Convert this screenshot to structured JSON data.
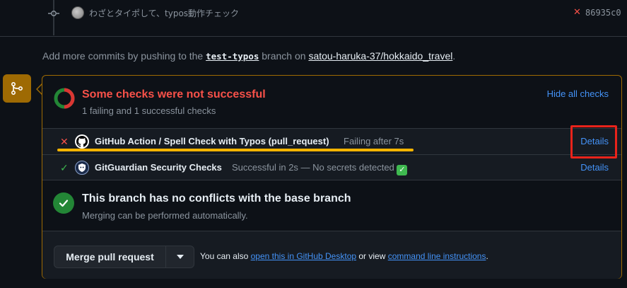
{
  "commit": {
    "message": "わざとタイポして、typos動作チェック",
    "status_icon": "x-icon",
    "sha": "86935c0"
  },
  "add_more": {
    "prefix": "Add more commits by pushing to the ",
    "branch": "test-typos",
    "middle": " branch on ",
    "repo": "satou-haruka-37/hokkaido_travel",
    "suffix": "."
  },
  "checks": {
    "title": "Some checks were not successful",
    "subtitle": "1 failing and 1 successful checks",
    "hide_label": "Hide all checks",
    "items": [
      {
        "status": "failing",
        "name": "GitHub Action / Spell Check with Typos (pull_request)",
        "description": "Failing after 7s",
        "details_label": "Details"
      },
      {
        "status": "success",
        "name": "GitGuardian Security Checks",
        "description": "Successful in 2s — No secrets detected",
        "details_label": "Details"
      }
    ]
  },
  "conflicts": {
    "title": "This branch has no conflicts with the base branch",
    "subtitle": "Merging can be performed automatically."
  },
  "merge": {
    "button_label": "Merge pull request",
    "hint_prefix": "You can also ",
    "desktop_link": "open this in GitHub Desktop",
    "hint_middle": " or view ",
    "cli_link": "command line instructions",
    "hint_suffix": "."
  },
  "colors": {
    "fail": "#f85149",
    "success": "#3fb950",
    "link": "#4493f8",
    "warning_border": "#9e6a03",
    "annotation_box": "#e8231b",
    "annotation_underline": "#f5b400"
  }
}
